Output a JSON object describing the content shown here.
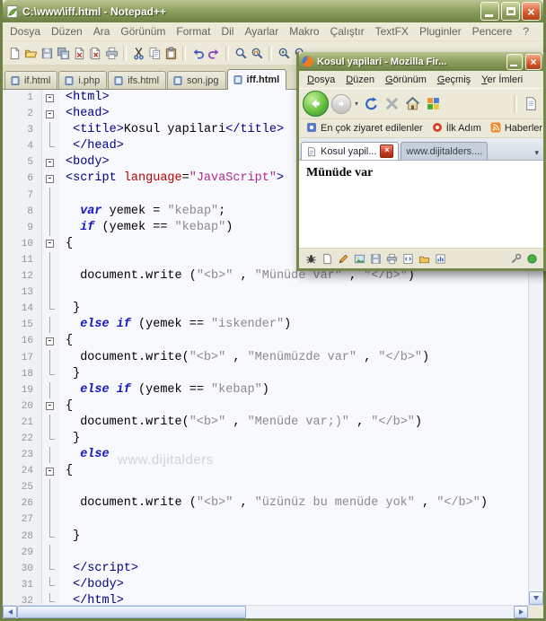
{
  "notepad": {
    "title": "C:\\www\\iff.html - Notepad++",
    "menu": [
      "Dosya",
      "Düzen",
      "Ara",
      "Görünüm",
      "Format",
      "Dil",
      "Ayarlar",
      "Makro",
      "Çalıştır",
      "TextFX",
      "Pluginler",
      "Pencere",
      "?"
    ],
    "toolbar_icons": [
      "new-file",
      "open-folder",
      "save",
      "save-all",
      "close",
      "close-all",
      "print",
      "separator",
      "cut",
      "copy",
      "paste",
      "separator",
      "undo",
      "redo",
      "separator",
      "find",
      "replace",
      "separator",
      "zoom-in",
      "zoom-out"
    ],
    "tabs": [
      {
        "label": "if.html",
        "active": false
      },
      {
        "label": "i.php",
        "active": false
      },
      {
        "label": "ifs.html",
        "active": false
      },
      {
        "label": "son.jpg",
        "active": false
      },
      {
        "label": "iff.html",
        "active": true
      }
    ],
    "editor": {
      "watermark": "www.dijitalders",
      "lines": [
        {
          "n": 1,
          "f": "box",
          "tk": [
            {
              "t": "g",
              "v": "<html>"
            }
          ]
        },
        {
          "n": 2,
          "f": "box",
          "tk": [
            {
              "t": "g",
              "v": "<head>"
            }
          ]
        },
        {
          "n": 3,
          "f": "line",
          "tk": [
            {
              "t": "p",
              "v": " "
            },
            {
              "t": "g",
              "v": "<title>"
            },
            {
              "t": "p",
              "v": "Kosul yapilari"
            },
            {
              "t": "g",
              "v": "</title>"
            }
          ]
        },
        {
          "n": 4,
          "f": "end",
          "tk": [
            {
              "t": "p",
              "v": " "
            },
            {
              "t": "g",
              "v": "</head>"
            }
          ]
        },
        {
          "n": 5,
          "f": "box",
          "tk": [
            {
              "t": "g",
              "v": "<body>"
            }
          ]
        },
        {
          "n": 6,
          "f": "box",
          "tk": [
            {
              "t": "g",
              "v": "<script "
            },
            {
              "t": "a",
              "v": "language"
            },
            {
              "t": "p",
              "v": "="
            },
            {
              "t": "h",
              "v": "\"JavaScript\""
            },
            {
              "t": "g",
              "v": ">"
            }
          ]
        },
        {
          "n": 7,
          "f": "line",
          "tk": []
        },
        {
          "n": 8,
          "f": "line",
          "tk": [
            {
              "t": "p",
              "v": "  "
            },
            {
              "t": "k",
              "v": "var"
            },
            {
              "t": "p",
              "v": " yemek = "
            },
            {
              "t": "s",
              "v": "\"kebap\""
            },
            {
              "t": "p",
              "v": ";"
            }
          ]
        },
        {
          "n": 9,
          "f": "line",
          "tk": [
            {
              "t": "p",
              "v": "  "
            },
            {
              "t": "k",
              "v": "if"
            },
            {
              "t": "p",
              "v": " (yemek == "
            },
            {
              "t": "s",
              "v": "\"kebap\""
            },
            {
              "t": "p",
              "v": ")"
            }
          ]
        },
        {
          "n": 10,
          "f": "box",
          "tk": [
            {
              "t": "p",
              "v": "{"
            }
          ]
        },
        {
          "n": 11,
          "f": "line",
          "tk": []
        },
        {
          "n": 12,
          "f": "line",
          "tk": [
            {
              "t": "p",
              "v": "  document.write ("
            },
            {
              "t": "s",
              "v": "\"<b>\""
            },
            {
              "t": "p",
              "v": " , "
            },
            {
              "t": "s",
              "v": "\"Münüde var\""
            },
            {
              "t": "p",
              "v": " , "
            },
            {
              "t": "s",
              "v": "\"</b>\""
            },
            {
              "t": "p",
              "v": ")"
            }
          ]
        },
        {
          "n": 13,
          "f": "line",
          "tk": []
        },
        {
          "n": 14,
          "f": "end",
          "tk": [
            {
              "t": "p",
              "v": " }"
            }
          ]
        },
        {
          "n": 15,
          "f": "line",
          "tk": [
            {
              "t": "p",
              "v": "  "
            },
            {
              "t": "k",
              "v": "else if"
            },
            {
              "t": "p",
              "v": " (yemek == "
            },
            {
              "t": "s",
              "v": "\"iskender\""
            },
            {
              "t": "p",
              "v": ")"
            }
          ]
        },
        {
          "n": 16,
          "f": "box",
          "tk": [
            {
              "t": "p",
              "v": "{"
            }
          ]
        },
        {
          "n": 17,
          "f": "line",
          "tk": [
            {
              "t": "p",
              "v": "  document.write("
            },
            {
              "t": "s",
              "v": "\"<b>\""
            },
            {
              "t": "p",
              "v": " , "
            },
            {
              "t": "s",
              "v": "\"Menümüzde var\""
            },
            {
              "t": "p",
              "v": " , "
            },
            {
              "t": "s",
              "v": "\"</b>\""
            },
            {
              "t": "p",
              "v": ")"
            }
          ]
        },
        {
          "n": 18,
          "f": "end",
          "tk": [
            {
              "t": "p",
              "v": " }"
            }
          ]
        },
        {
          "n": 19,
          "f": "line",
          "tk": [
            {
              "t": "p",
              "v": "  "
            },
            {
              "t": "k",
              "v": "else if"
            },
            {
              "t": "p",
              "v": " (yemek == "
            },
            {
              "t": "s",
              "v": "\"kebap\""
            },
            {
              "t": "p",
              "v": ")"
            }
          ]
        },
        {
          "n": 20,
          "f": "box",
          "tk": [
            {
              "t": "p",
              "v": "{"
            }
          ]
        },
        {
          "n": 21,
          "f": "line",
          "tk": [
            {
              "t": "p",
              "v": "  document.write("
            },
            {
              "t": "s",
              "v": "\"<b>\""
            },
            {
              "t": "p",
              "v": " , "
            },
            {
              "t": "s",
              "v": "\"Menüde var;)\""
            },
            {
              "t": "p",
              "v": " , "
            },
            {
              "t": "s",
              "v": "\"</b>\""
            },
            {
              "t": "p",
              "v": ")"
            }
          ]
        },
        {
          "n": 22,
          "f": "end",
          "tk": [
            {
              "t": "p",
              "v": " }"
            }
          ]
        },
        {
          "n": 23,
          "f": "line",
          "tk": [
            {
              "t": "p",
              "v": "  "
            },
            {
              "t": "k",
              "v": "else"
            }
          ]
        },
        {
          "n": 24,
          "f": "box",
          "tk": [
            {
              "t": "p",
              "v": "{"
            }
          ]
        },
        {
          "n": 25,
          "f": "line",
          "tk": []
        },
        {
          "n": 26,
          "f": "line",
          "tk": [
            {
              "t": "p",
              "v": "  document.write ("
            },
            {
              "t": "s",
              "v": "\"<b>\""
            },
            {
              "t": "p",
              "v": " , "
            },
            {
              "t": "s",
              "v": "\"üzünüz bu menüde yok\""
            },
            {
              "t": "p",
              "v": " , "
            },
            {
              "t": "s",
              "v": "\"</b>\""
            },
            {
              "t": "p",
              "v": ")"
            }
          ]
        },
        {
          "n": 27,
          "f": "line",
          "tk": []
        },
        {
          "n": 28,
          "f": "end",
          "tk": [
            {
              "t": "p",
              "v": " }"
            }
          ]
        },
        {
          "n": 29,
          "f": "line",
          "tk": []
        },
        {
          "n": 30,
          "f": "end",
          "tk": [
            {
              "t": "p",
              "v": " "
            },
            {
              "t": "g",
              "v": "</script>"
            }
          ]
        },
        {
          "n": 31,
          "f": "end",
          "tk": [
            {
              "t": "p",
              "v": " "
            },
            {
              "t": "g",
              "v": "</body>"
            }
          ]
        },
        {
          "n": 32,
          "f": "end",
          "tk": [
            {
              "t": "p",
              "v": " "
            },
            {
              "t": "g",
              "v": "</html>"
            }
          ]
        }
      ]
    }
  },
  "firefox": {
    "title": "Kosul yapilari - Mozilla Fir...",
    "menu": [
      "Dosya",
      "Düzen",
      "Görünüm",
      "Geçmiş",
      "Yer İmleri"
    ],
    "navbar_icons": [
      "back",
      "forward",
      "history-dropdown",
      "reload",
      "stop",
      "home",
      "quick-launch-grid",
      "new-page"
    ],
    "bookmarks": [
      {
        "label": "En çok ziyaret edilenler",
        "icon": "most-visited"
      },
      {
        "label": "İlk Adım",
        "icon": "getting-started"
      },
      {
        "label": "Haberler",
        "icon": "news-feed"
      }
    ],
    "tabs": [
      {
        "label": "Kosul yapil...",
        "active": true,
        "closable": true
      },
      {
        "label": "www.dijitalders....",
        "active": false,
        "closable": false
      }
    ],
    "content_text": "Münüde var",
    "statusbar_icons": [
      "bug",
      "document",
      "edit",
      "image",
      "save",
      "print",
      "code",
      "folder",
      "chart",
      "tools",
      "status-ok"
    ]
  },
  "colors": {
    "titlebar_olive": "#93a565",
    "close_button_red": "#d85f35",
    "back_button_green": "#2f8d2b",
    "syntax_tag": "#000080",
    "syntax_attribute": "#bf0000",
    "syntax_html_value": "#b1288c",
    "syntax_js_keyword": "#1515c0",
    "syntax_js_string": "#8a8a8a"
  }
}
